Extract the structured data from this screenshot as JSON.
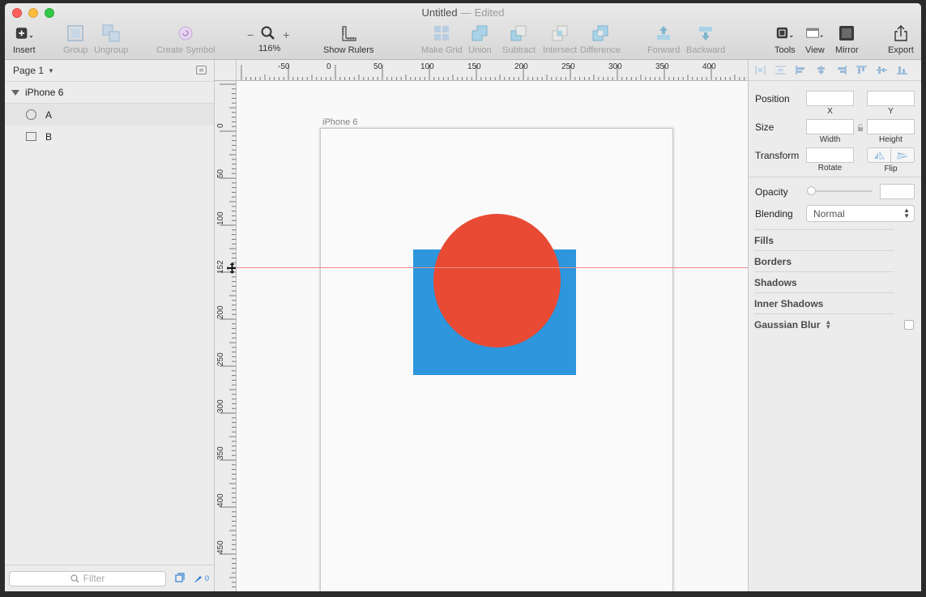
{
  "window": {
    "title": "Untitled",
    "separator": "—",
    "status": "Edited"
  },
  "toolbar": {
    "insert": "Insert",
    "group": "Group",
    "ungroup": "Ungroup",
    "create_symbol": "Create Symbol",
    "zoom_minus": "−",
    "zoom_plus": "+",
    "zoom_level": "116%",
    "show_rulers": "Show Rulers",
    "make_grid": "Make Grid",
    "union": "Union",
    "subtract": "Subtract",
    "intersect": "Intersect",
    "difference": "Difference",
    "forward": "Forward",
    "backward": "Backward",
    "tools": "Tools",
    "view": "View",
    "mirror": "Mirror",
    "export": "Export"
  },
  "layers": {
    "page": "Page 1",
    "artboard": "iPhone 6",
    "items": [
      {
        "name": "A",
        "shape": "oval"
      },
      {
        "name": "B",
        "shape": "rectangle"
      }
    ],
    "filter_placeholder": "Filter",
    "slice_count": "0"
  },
  "rulers": {
    "horizontal": [
      "-50",
      "0",
      "50",
      "100",
      "150",
      "200",
      "250",
      "300",
      "350",
      "400"
    ],
    "vertical": [
      "0",
      "50",
      "100",
      "152",
      "200",
      "250",
      "300",
      "350",
      "400",
      "450"
    ],
    "guide_value": "152"
  },
  "canvas": {
    "artboard_name": "iPhone 6",
    "rect_color": "#2d96dc",
    "oval_color": "#e84a34",
    "guide_color": "#f08a8a"
  },
  "inspector": {
    "position": "Position",
    "x": "X",
    "y": "Y",
    "size": "Size",
    "width": "Width",
    "height": "Height",
    "transform": "Transform",
    "rotate": "Rotate",
    "flip": "Flip",
    "opacity": "Opacity",
    "blending": "Blending",
    "blending_value": "Normal",
    "fills": "Fills",
    "borders": "Borders",
    "shadows": "Shadows",
    "inner_shadows": "Inner Shadows",
    "gaussian_blur": "Gaussian Blur"
  }
}
